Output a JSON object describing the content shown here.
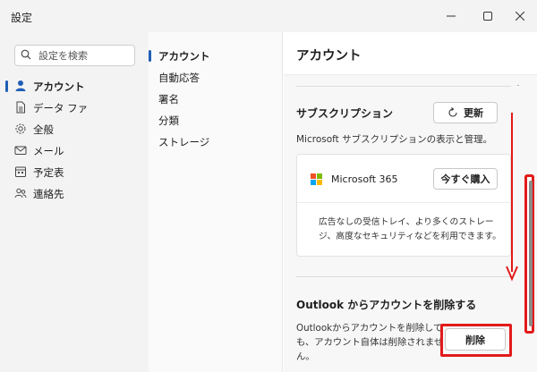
{
  "window": {
    "title": "設定"
  },
  "search": {
    "placeholder": "設定を検索"
  },
  "nav": {
    "items": [
      {
        "label": "アカウント",
        "icon": "person-icon"
      },
      {
        "label": "データ ファ",
        "icon": "document-icon"
      },
      {
        "label": "全般",
        "icon": "gear-icon"
      },
      {
        "label": "メール",
        "icon": "mail-icon"
      },
      {
        "label": "予定表",
        "icon": "calendar-icon"
      },
      {
        "label": "連絡先",
        "icon": "people-icon"
      }
    ]
  },
  "subnav": {
    "items": [
      {
        "label": "アカウント"
      },
      {
        "label": "自動応答"
      },
      {
        "label": "署名"
      },
      {
        "label": "分類"
      },
      {
        "label": "ストレージ"
      }
    ]
  },
  "content": {
    "title": "アカウント",
    "subscription": {
      "title": "サブスクリプション",
      "refresh_label": "更新",
      "description": "Microsoft サブスクリプションの表示と管理。",
      "product_name": "Microsoft 365",
      "buy_label": "今すぐ購入",
      "product_description": "広告なしの受信トレイ、より多くのストレージ、高度なセキュリティなどを利用できます。"
    },
    "remove": {
      "title": "Outlook からアカウントを削除する",
      "description": "Outlookからアカウントを削除しても、アカウント自体は削除されません。",
      "delete_label": "削除"
    }
  },
  "colors": {
    "accent": "#1f5eb6",
    "annotation": "#e21a1a",
    "ms_red": "#f25022",
    "ms_green": "#7fba00",
    "ms_blue": "#00a4ef",
    "ms_yellow": "#ffb900"
  }
}
